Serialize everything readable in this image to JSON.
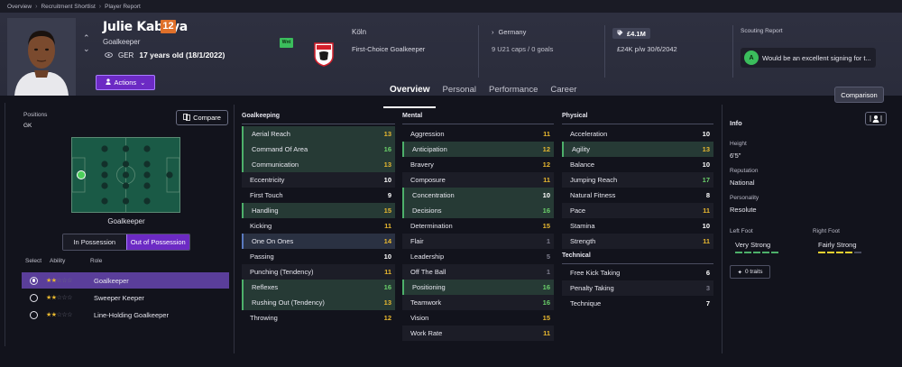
{
  "breadcrumb": [
    "Overview",
    "Recruitment Shortlist",
    "Player Report"
  ],
  "player": {
    "name": "Julie Kabeya",
    "ca": "12",
    "position": "Goalkeeper",
    "nation_code": "GER",
    "age_text": "17 years old (18/1/2022)",
    "status_badge": "Wnt",
    "club": "Köln",
    "squad_role": "First-Choice Goalkeeper",
    "country": "Germany",
    "caps": "9 U21 caps / 0 goals",
    "value": "£4.1M",
    "wage": "£24K p/w  30/6/2042",
    "scouting_label": "Scouting Report",
    "scouting_grade": "A",
    "scouting_text": "Would be an excellent signing for t..."
  },
  "actions_label": "Actions",
  "tabs": [
    "Overview",
    "Personal",
    "Performance",
    "Career"
  ],
  "comparison_label": "Comparison",
  "left": {
    "positions_label": "Positions",
    "positions_value": "GK",
    "compare_label": "Compare",
    "pitch_position_label": "Goalkeeper",
    "possession": {
      "in": "In Possession",
      "out": "Out of Possession"
    },
    "role_headers": {
      "select": "Select",
      "ability": "Ability",
      "role": "Role"
    },
    "roles": [
      {
        "name": "Goalkeeper",
        "stars": 2,
        "selected": true
      },
      {
        "name": "Sweeper Keeper",
        "stars": 2,
        "selected": false
      },
      {
        "name": "Line-Holding Goalkeeper",
        "stars": 2,
        "selected": false
      }
    ]
  },
  "colors": {
    "high": "#e8b830",
    "green": "#6ad06a",
    "white": "#ffffff",
    "grey": "#7c7c8c",
    "accent": "#6c2ac4"
  },
  "attributes": {
    "goalkeeping": {
      "title": "Goalkeeping",
      "items": [
        {
          "name": "Aerial Reach",
          "value": "13",
          "hl": "green",
          "color": "high"
        },
        {
          "name": "Command Of Area",
          "value": "16",
          "hl": "green",
          "color": "green"
        },
        {
          "name": "Communication",
          "value": "13",
          "hl": "green",
          "color": "high"
        },
        {
          "name": "Eccentricity",
          "value": "10",
          "hl": "",
          "color": "white"
        },
        {
          "name": "First Touch",
          "value": "9",
          "hl": "",
          "color": "white"
        },
        {
          "name": "Handling",
          "value": "15",
          "hl": "green",
          "color": "high"
        },
        {
          "name": "Kicking",
          "value": "11",
          "hl": "",
          "color": "high"
        },
        {
          "name": "One On Ones",
          "value": "14",
          "hl": "blue",
          "color": "high"
        },
        {
          "name": "Passing",
          "value": "10",
          "hl": "",
          "color": "white"
        },
        {
          "name": "Punching (Tendency)",
          "value": "11",
          "hl": "",
          "color": "high"
        },
        {
          "name": "Reflexes",
          "value": "16",
          "hl": "green",
          "color": "green"
        },
        {
          "name": "Rushing Out (Tendency)",
          "value": "13",
          "hl": "green",
          "color": "high"
        },
        {
          "name": "Throwing",
          "value": "12",
          "hl": "",
          "color": "high"
        }
      ]
    },
    "mental": {
      "title": "Mental",
      "items": [
        {
          "name": "Aggression",
          "value": "11",
          "hl": "",
          "color": "high"
        },
        {
          "name": "Anticipation",
          "value": "12",
          "hl": "green",
          "color": "high"
        },
        {
          "name": "Bravery",
          "value": "12",
          "hl": "",
          "color": "high"
        },
        {
          "name": "Composure",
          "value": "11",
          "hl": "",
          "color": "high"
        },
        {
          "name": "Concentration",
          "value": "10",
          "hl": "green",
          "color": "white"
        },
        {
          "name": "Decisions",
          "value": "16",
          "hl": "green",
          "color": "green"
        },
        {
          "name": "Determination",
          "value": "15",
          "hl": "",
          "color": "high"
        },
        {
          "name": "Flair",
          "value": "1",
          "hl": "",
          "color": "grey"
        },
        {
          "name": "Leadership",
          "value": "5",
          "hl": "",
          "color": "grey"
        },
        {
          "name": "Off The Ball",
          "value": "1",
          "hl": "",
          "color": "grey"
        },
        {
          "name": "Positioning",
          "value": "16",
          "hl": "green",
          "color": "green"
        },
        {
          "name": "Teamwork",
          "value": "16",
          "hl": "",
          "color": "green"
        },
        {
          "name": "Vision",
          "value": "15",
          "hl": "",
          "color": "high"
        },
        {
          "name": "Work Rate",
          "value": "11",
          "hl": "",
          "color": "high"
        }
      ]
    },
    "physical": {
      "title": "Physical",
      "items": [
        {
          "name": "Acceleration",
          "value": "10",
          "hl": "",
          "color": "white"
        },
        {
          "name": "Agility",
          "value": "13",
          "hl": "green",
          "color": "high"
        },
        {
          "name": "Balance",
          "value": "10",
          "hl": "",
          "color": "white"
        },
        {
          "name": "Jumping Reach",
          "value": "17",
          "hl": "",
          "color": "green"
        },
        {
          "name": "Natural Fitness",
          "value": "8",
          "hl": "",
          "color": "white"
        },
        {
          "name": "Pace",
          "value": "11",
          "hl": "",
          "color": "high"
        },
        {
          "name": "Stamina",
          "value": "10",
          "hl": "",
          "color": "white"
        },
        {
          "name": "Strength",
          "value": "11",
          "hl": "",
          "color": "high"
        }
      ]
    },
    "technical": {
      "title": "Technical",
      "items": [
        {
          "name": "Free Kick Taking",
          "value": "6",
          "hl": "",
          "color": "white"
        },
        {
          "name": "Penalty Taking",
          "value": "3",
          "hl": "",
          "color": "grey"
        },
        {
          "name": "Technique",
          "value": "7",
          "hl": "",
          "color": "white"
        }
      ]
    }
  },
  "info": {
    "title": "Info",
    "height_label": "Height",
    "height": "6'5\"",
    "reputation_label": "Reputation",
    "reputation": "National",
    "personality_label": "Personality",
    "personality": "Resolute",
    "left_foot_label": "Left Foot",
    "left_foot": "Very Strong",
    "right_foot_label": "Right Foot",
    "right_foot": "Fairly Strong",
    "traits": "0 traits"
  }
}
